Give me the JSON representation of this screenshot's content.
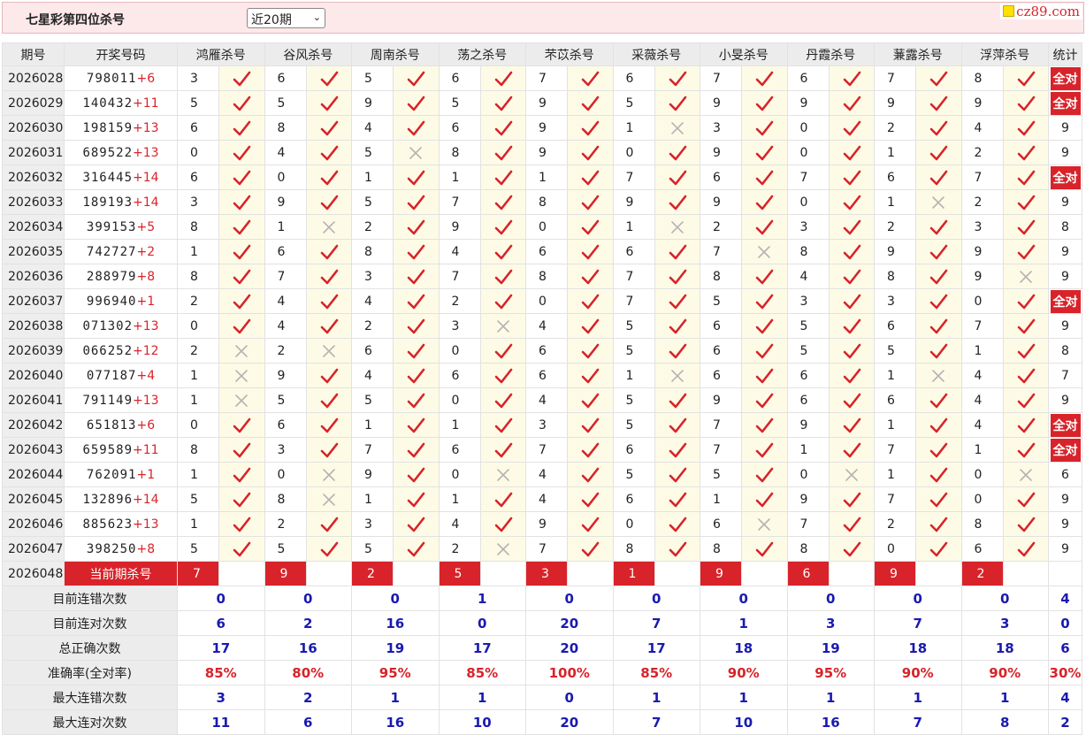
{
  "header": {
    "title": "七星彩第四位杀号",
    "period_select": "近20期",
    "logo": "cz89.com"
  },
  "columns": {
    "issue": "期号",
    "draw": "开奖号码",
    "stat": "统计",
    "killers": [
      "鸿雁杀号",
      "谷风杀号",
      "周南杀号",
      "荡之杀号",
      "芣苡杀号",
      "采薇杀号",
      "小旻杀号",
      "丹霞杀号",
      "蒹露杀号",
      "浮萍杀号"
    ]
  },
  "colors": {
    "accent": "#d8232a",
    "blue": "#1a1ab0",
    "cell_bg": "#fdfbe6"
  },
  "rows": [
    {
      "issue": "2026028",
      "draw": "798011",
      "extra": "+6",
      "kills": [
        "3",
        "6",
        "5",
        "6",
        "7",
        "6",
        "7",
        "6",
        "7",
        "8"
      ],
      "marks": [
        1,
        1,
        1,
        1,
        1,
        1,
        1,
        1,
        1,
        1
      ],
      "stat": "全对"
    },
    {
      "issue": "2026029",
      "draw": "140432",
      "extra": "+11",
      "kills": [
        "5",
        "5",
        "9",
        "5",
        "9",
        "5",
        "9",
        "9",
        "9",
        "9"
      ],
      "marks": [
        1,
        1,
        1,
        1,
        1,
        1,
        1,
        1,
        1,
        1
      ],
      "stat": "全对"
    },
    {
      "issue": "2026030",
      "draw": "198159",
      "extra": "+13",
      "kills": [
        "6",
        "8",
        "4",
        "6",
        "9",
        "1",
        "3",
        "0",
        "2",
        "4"
      ],
      "marks": [
        1,
        1,
        1,
        1,
        1,
        0,
        1,
        1,
        1,
        1
      ],
      "stat": "9"
    },
    {
      "issue": "2026031",
      "draw": "689522",
      "extra": "+13",
      "kills": [
        "0",
        "4",
        "5",
        "8",
        "9",
        "0",
        "9",
        "0",
        "1",
        "2"
      ],
      "marks": [
        1,
        1,
        0,
        1,
        1,
        1,
        1,
        1,
        1,
        1
      ],
      "stat": "9"
    },
    {
      "issue": "2026032",
      "draw": "316445",
      "extra": "+14",
      "kills": [
        "6",
        "0",
        "1",
        "1",
        "1",
        "7",
        "6",
        "7",
        "6",
        "7"
      ],
      "marks": [
        1,
        1,
        1,
        1,
        1,
        1,
        1,
        1,
        1,
        1
      ],
      "stat": "全对"
    },
    {
      "issue": "2026033",
      "draw": "189193",
      "extra": "+14",
      "kills": [
        "3",
        "9",
        "5",
        "7",
        "8",
        "9",
        "9",
        "0",
        "1",
        "2"
      ],
      "marks": [
        1,
        1,
        1,
        1,
        1,
        1,
        1,
        1,
        0,
        1
      ],
      "stat": "9"
    },
    {
      "issue": "2026034",
      "draw": "399153",
      "extra": "+5",
      "kills": [
        "8",
        "1",
        "2",
        "9",
        "0",
        "1",
        "2",
        "3",
        "2",
        "3"
      ],
      "marks": [
        1,
        0,
        1,
        1,
        1,
        0,
        1,
        1,
        1,
        1
      ],
      "stat": "8"
    },
    {
      "issue": "2026035",
      "draw": "742727",
      "extra": "+2",
      "kills": [
        "1",
        "6",
        "8",
        "4",
        "6",
        "6",
        "7",
        "8",
        "9",
        "9"
      ],
      "marks": [
        1,
        1,
        1,
        1,
        1,
        1,
        0,
        1,
        1,
        1
      ],
      "stat": "9"
    },
    {
      "issue": "2026036",
      "draw": "288979",
      "extra": "+8",
      "kills": [
        "8",
        "7",
        "3",
        "7",
        "8",
        "7",
        "8",
        "4",
        "8",
        "9"
      ],
      "marks": [
        1,
        1,
        1,
        1,
        1,
        1,
        1,
        1,
        1,
        0
      ],
      "stat": "9"
    },
    {
      "issue": "2026037",
      "draw": "996940",
      "extra": "+1",
      "kills": [
        "2",
        "4",
        "4",
        "2",
        "0",
        "7",
        "5",
        "3",
        "3",
        "0"
      ],
      "marks": [
        1,
        1,
        1,
        1,
        1,
        1,
        1,
        1,
        1,
        1
      ],
      "stat": "全对"
    },
    {
      "issue": "2026038",
      "draw": "071302",
      "extra": "+13",
      "kills": [
        "0",
        "4",
        "2",
        "3",
        "4",
        "5",
        "6",
        "5",
        "6",
        "7"
      ],
      "marks": [
        1,
        1,
        1,
        0,
        1,
        1,
        1,
        1,
        1,
        1
      ],
      "stat": "9"
    },
    {
      "issue": "2026039",
      "draw": "066252",
      "extra": "+12",
      "kills": [
        "2",
        "2",
        "6",
        "0",
        "6",
        "5",
        "6",
        "5",
        "5",
        "1"
      ],
      "marks": [
        0,
        0,
        1,
        1,
        1,
        1,
        1,
        1,
        1,
        1
      ],
      "stat": "8"
    },
    {
      "issue": "2026040",
      "draw": "077187",
      "extra": "+4",
      "kills": [
        "1",
        "9",
        "4",
        "6",
        "6",
        "1",
        "6",
        "6",
        "1",
        "4"
      ],
      "marks": [
        0,
        1,
        1,
        1,
        1,
        0,
        1,
        1,
        0,
        1
      ],
      "stat": "7"
    },
    {
      "issue": "2026041",
      "draw": "791149",
      "extra": "+13",
      "kills": [
        "1",
        "5",
        "5",
        "0",
        "4",
        "5",
        "9",
        "6",
        "6",
        "4"
      ],
      "marks": [
        0,
        1,
        1,
        1,
        1,
        1,
        1,
        1,
        1,
        1
      ],
      "stat": "9"
    },
    {
      "issue": "2026042",
      "draw": "651813",
      "extra": "+6",
      "kills": [
        "0",
        "6",
        "1",
        "1",
        "3",
        "5",
        "7",
        "9",
        "1",
        "4"
      ],
      "marks": [
        1,
        1,
        1,
        1,
        1,
        1,
        1,
        1,
        1,
        1
      ],
      "stat": "全对"
    },
    {
      "issue": "2026043",
      "draw": "659589",
      "extra": "+11",
      "kills": [
        "8",
        "3",
        "7",
        "6",
        "7",
        "6",
        "7",
        "1",
        "7",
        "1"
      ],
      "marks": [
        1,
        1,
        1,
        1,
        1,
        1,
        1,
        1,
        1,
        1
      ],
      "stat": "全对"
    },
    {
      "issue": "2026044",
      "draw": "762091",
      "extra": "+1",
      "kills": [
        "1",
        "0",
        "9",
        "0",
        "4",
        "5",
        "5",
        "0",
        "1",
        "0"
      ],
      "marks": [
        1,
        0,
        1,
        0,
        1,
        1,
        1,
        0,
        1,
        0
      ],
      "stat": "6"
    },
    {
      "issue": "2026045",
      "draw": "132896",
      "extra": "+14",
      "kills": [
        "5",
        "8",
        "1",
        "1",
        "4",
        "6",
        "1",
        "9",
        "7",
        "0"
      ],
      "marks": [
        1,
        0,
        1,
        1,
        1,
        1,
        1,
        1,
        1,
        1
      ],
      "stat": "9"
    },
    {
      "issue": "2026046",
      "draw": "885623",
      "extra": "+13",
      "kills": [
        "1",
        "2",
        "3",
        "4",
        "9",
        "0",
        "6",
        "7",
        "2",
        "8"
      ],
      "marks": [
        1,
        1,
        1,
        1,
        1,
        1,
        0,
        1,
        1,
        1
      ],
      "stat": "9"
    },
    {
      "issue": "2026047",
      "draw": "398250",
      "extra": "+8",
      "kills": [
        "5",
        "5",
        "5",
        "2",
        "7",
        "8",
        "8",
        "8",
        "0",
        "6"
      ],
      "marks": [
        1,
        1,
        1,
        0,
        1,
        1,
        1,
        1,
        1,
        1
      ],
      "stat": "9"
    }
  ],
  "current": {
    "issue": "2026048",
    "label": "当前期杀号",
    "kills": [
      "7",
      "9",
      "2",
      "5",
      "3",
      "1",
      "9",
      "6",
      "9",
      "2"
    ]
  },
  "summary": [
    {
      "label": "目前连错次数",
      "color": "blue",
      "values": [
        "0",
        "0",
        "0",
        "1",
        "0",
        "0",
        "0",
        "0",
        "0",
        "0"
      ],
      "stat": "4"
    },
    {
      "label": "目前连对次数",
      "color": "blue",
      "values": [
        "6",
        "2",
        "16",
        "0",
        "20",
        "7",
        "1",
        "3",
        "7",
        "3"
      ],
      "stat": "0"
    },
    {
      "label": "总正确次数",
      "color": "blue",
      "values": [
        "17",
        "16",
        "19",
        "17",
        "20",
        "17",
        "18",
        "19",
        "18",
        "18"
      ],
      "stat": "6"
    },
    {
      "label": "准确率(全对率)",
      "color": "red",
      "values": [
        "85%",
        "80%",
        "95%",
        "85%",
        "100%",
        "85%",
        "90%",
        "95%",
        "90%",
        "90%"
      ],
      "stat": "30%"
    },
    {
      "label": "最大连错次数",
      "color": "blue",
      "values": [
        "3",
        "2",
        "1",
        "1",
        "0",
        "1",
        "1",
        "1",
        "1",
        "1"
      ],
      "stat": "4"
    },
    {
      "label": "最大连对次数",
      "color": "blue",
      "values": [
        "11",
        "6",
        "16",
        "10",
        "20",
        "7",
        "10",
        "16",
        "7",
        "8"
      ],
      "stat": "2"
    }
  ]
}
